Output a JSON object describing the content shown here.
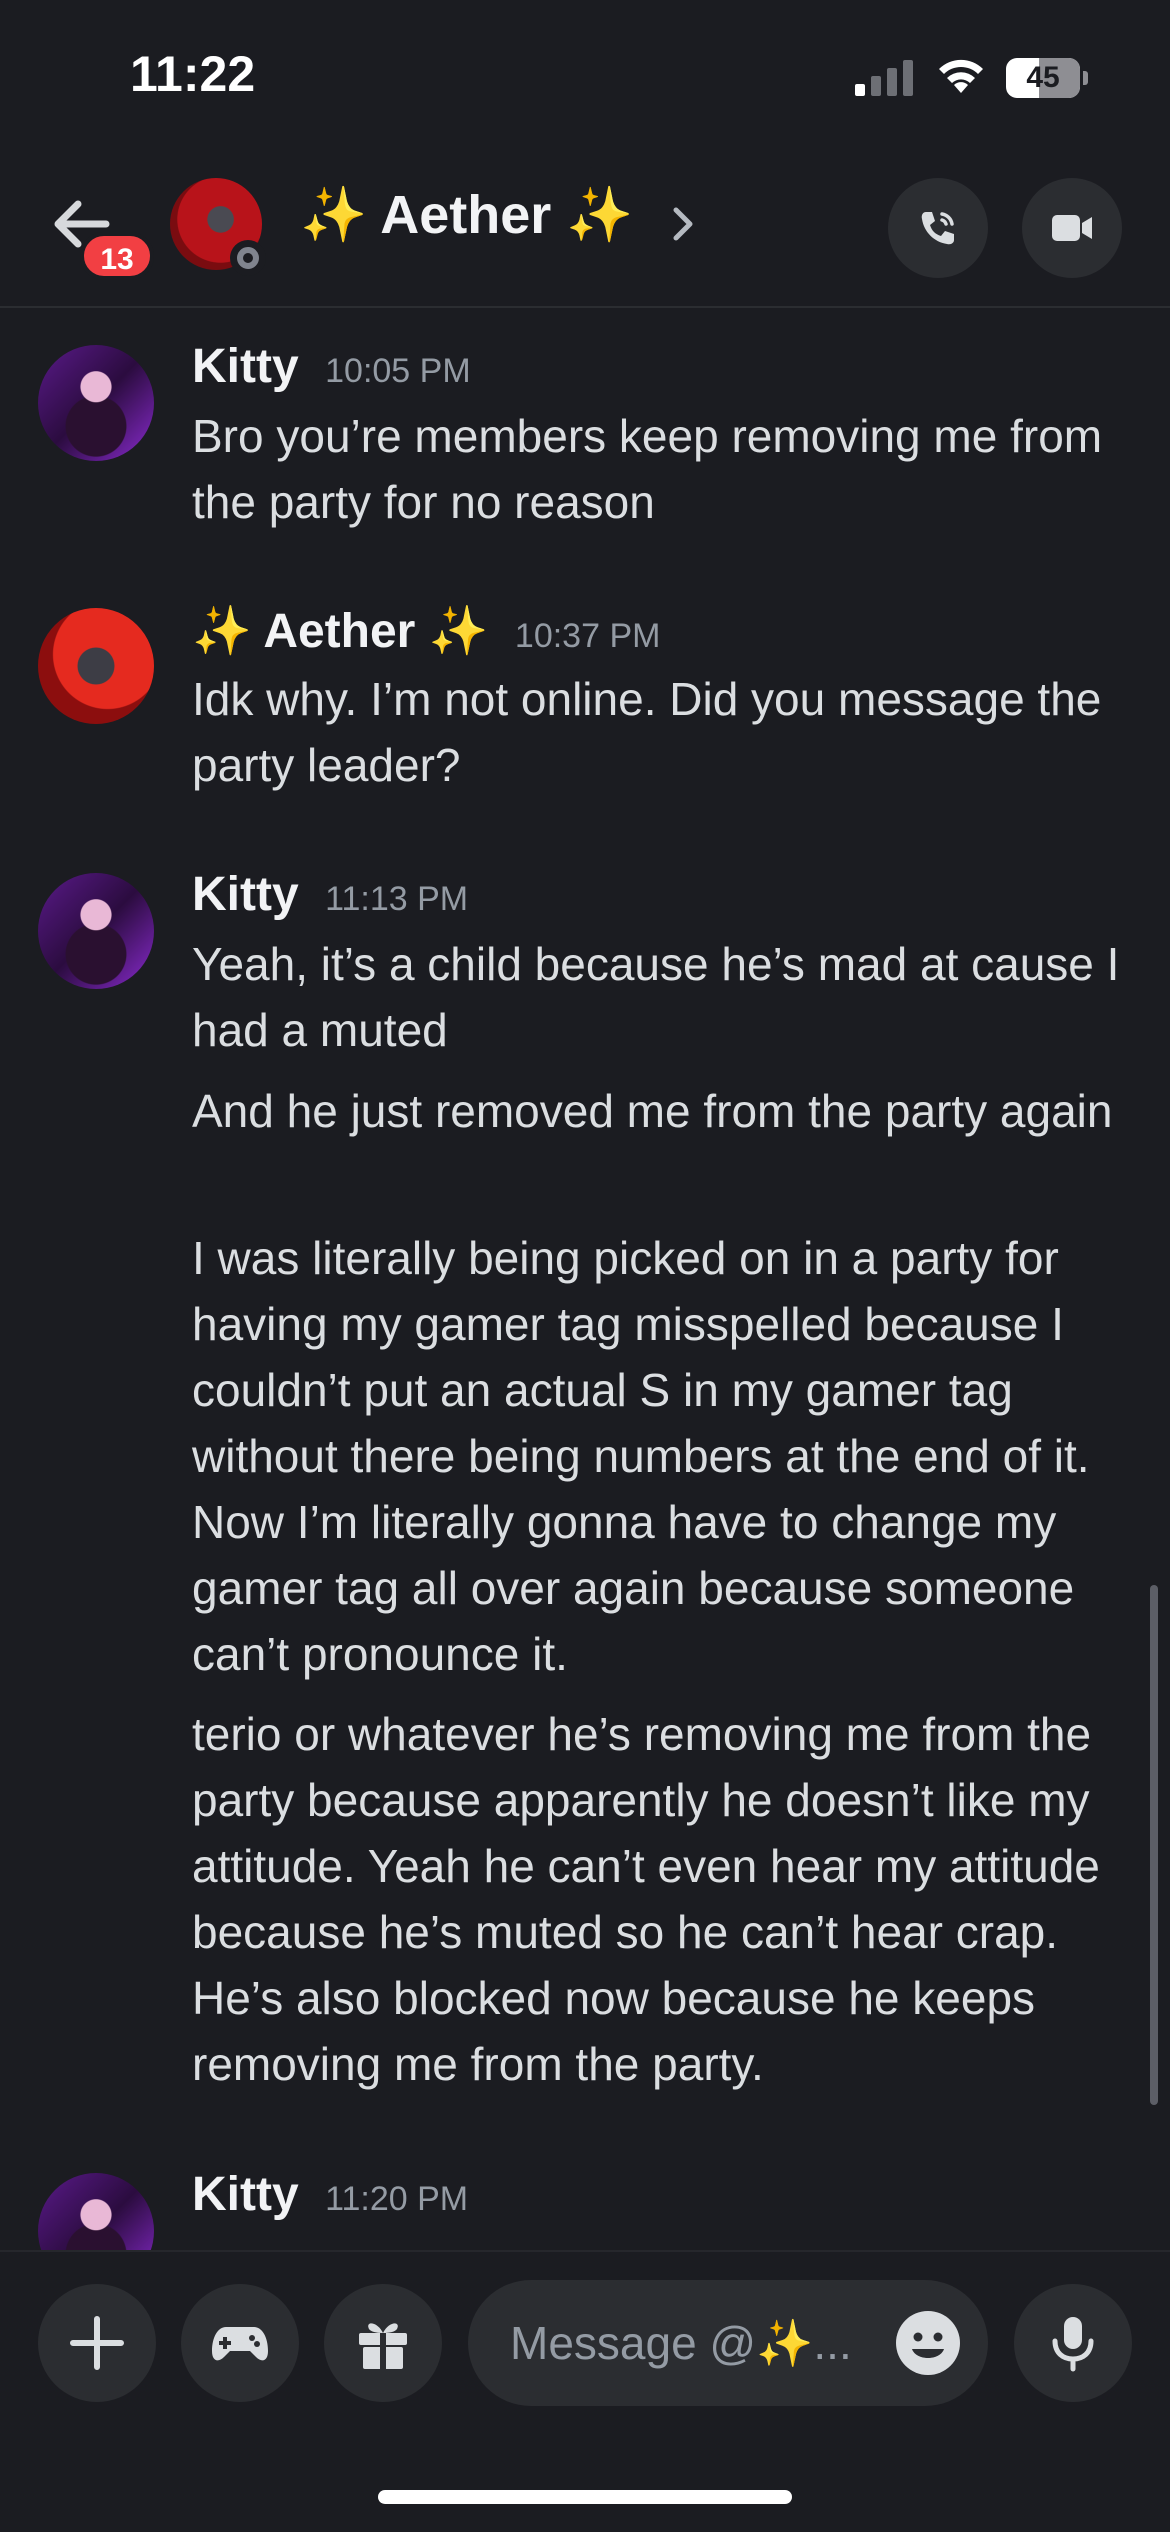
{
  "status_bar": {
    "time": "11:22",
    "battery_level": "45",
    "battery_fraction": 0.45
  },
  "header": {
    "unread_badge": "13",
    "channel_name": "✨ Aether ✨",
    "icons": [
      "back-arrow-icon",
      "chevron-right-icon",
      "phone-call-icon",
      "video-camera-icon"
    ]
  },
  "messages": [
    {
      "author": "Kitty",
      "timestamp": "10:05 PM",
      "avatar": "kitty",
      "lines": [
        "Bro you’re members keep removing me from the party for no reason"
      ]
    },
    {
      "author": "✨ Aether ✨",
      "timestamp": "10:37 PM",
      "avatar": "aether",
      "lines": [
        "Idk why. I’m not online. Did you message the party leader?"
      ]
    },
    {
      "author": "Kitty",
      "timestamp": "11:13 PM",
      "avatar": "kitty",
      "lines": [
        "Yeah, it’s a child because he’s mad at cause I had a muted",
        "And he just removed me from the party again",
        "I was literally being picked on in a party for having my gamer tag misspelled because I couldn’t put an actual S in my gamer tag without there being numbers at the end of it. Now I’m literally gonna have to change my gamer tag all over again because someone can’t pronounce it.",
        "terio or whatever he’s removing me from the party because apparently he doesn’t like my attitude. Yeah he can’t even hear my attitude because he’s muted so he can’t hear crap. He’s also blocked now because he keeps removing me from the party."
      ]
    },
    {
      "author": "Kitty",
      "timestamp": "11:20 PM",
      "avatar": "kitty",
      "lines": []
    }
  ],
  "composer": {
    "placeholder": "Message @✨...",
    "icons": [
      "plus-icon",
      "gamepad-icon",
      "gift-icon",
      "emoji-icon",
      "microphone-icon"
    ]
  }
}
